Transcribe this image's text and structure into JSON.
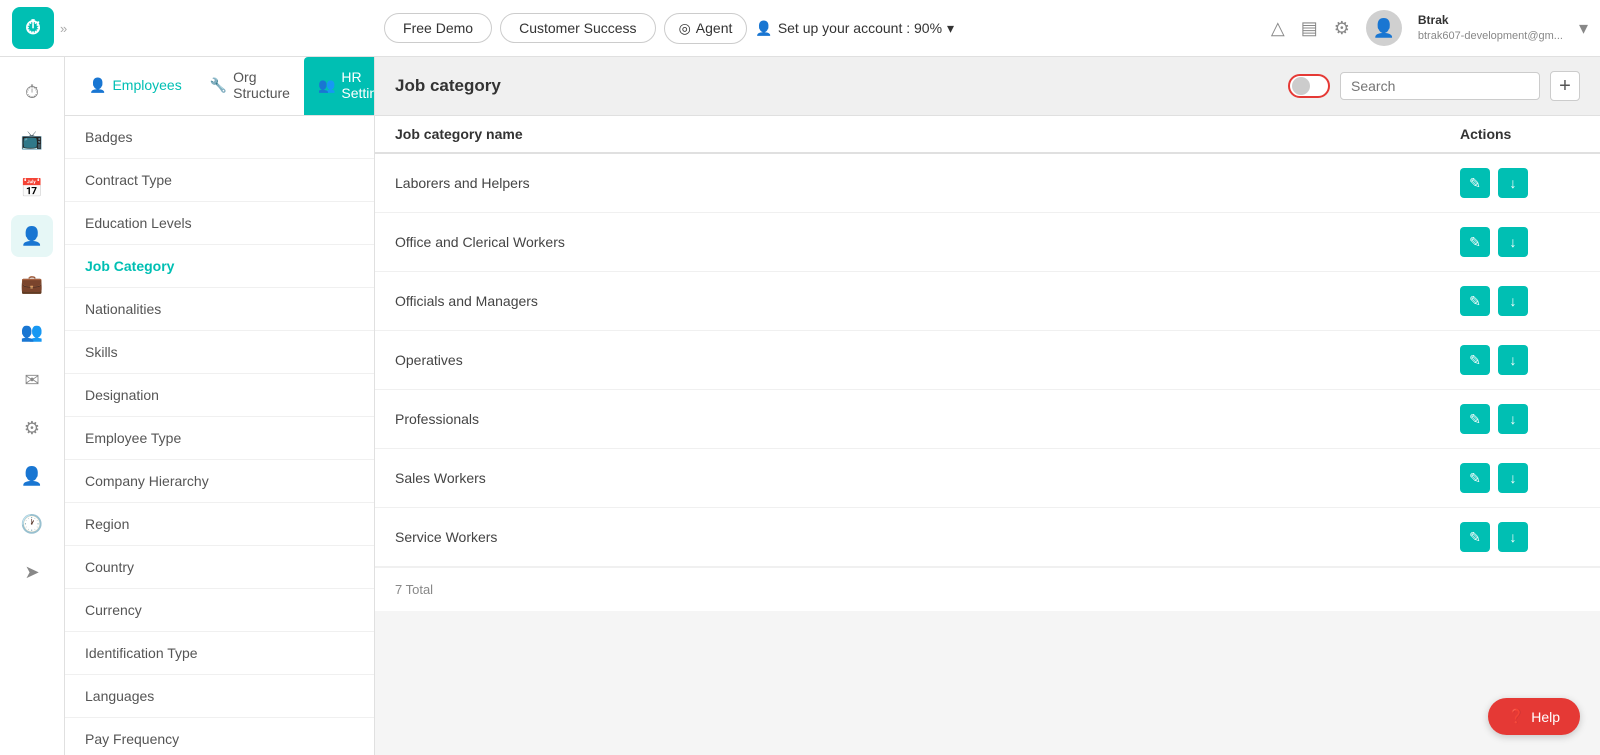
{
  "navbar": {
    "logo_text": "⏱",
    "expand_icon": "»",
    "free_demo_label": "Free Demo",
    "customer_success_label": "Customer Success",
    "agent_label": "Agent",
    "agent_icon": "◎",
    "setup_label": "Set up your account : 90%",
    "setup_icon": "▾",
    "alert_icon": "△",
    "doc_icon": "▤",
    "settings_icon": "⚙",
    "user_name": "Btrak",
    "user_email": "btrak607-development@gm...",
    "user_icon": "▾"
  },
  "left_sidebar": {
    "icons": [
      {
        "name": "clock-icon",
        "glyph": "⏱",
        "active": false
      },
      {
        "name": "tv-icon",
        "glyph": "📺",
        "active": false
      },
      {
        "name": "calendar-icon",
        "glyph": "📅",
        "active": false
      },
      {
        "name": "person-icon",
        "glyph": "👤",
        "active": true
      },
      {
        "name": "briefcase-icon",
        "glyph": "💼",
        "active": false
      },
      {
        "name": "group-icon",
        "glyph": "👥",
        "active": false
      },
      {
        "name": "mail-icon",
        "glyph": "✉",
        "active": false
      },
      {
        "name": "gear-icon",
        "glyph": "⚙",
        "active": false
      },
      {
        "name": "user2-icon",
        "glyph": "👤",
        "active": false
      },
      {
        "name": "time-icon",
        "glyph": "🕐",
        "active": false
      },
      {
        "name": "send-icon",
        "glyph": "➤",
        "active": false
      }
    ]
  },
  "sub_sidebar": {
    "tabs": [
      {
        "label": "Employees",
        "icon": "👤",
        "active": false,
        "class": "tab-employees"
      },
      {
        "label": "Org Structure",
        "icon": "🔧",
        "active": false,
        "class": "tab-org"
      },
      {
        "label": "HR Settings",
        "icon": "👥",
        "active": true,
        "class": "tab-hr"
      }
    ],
    "menu_items": [
      {
        "label": "Badges",
        "active": false
      },
      {
        "label": "Contract Type",
        "active": false
      },
      {
        "label": "Education Levels",
        "active": false
      },
      {
        "label": "Job Category",
        "active": true
      },
      {
        "label": "Nationalities",
        "active": false
      },
      {
        "label": "Skills",
        "active": false
      },
      {
        "label": "Designation",
        "active": false
      },
      {
        "label": "Employee Type",
        "active": false
      },
      {
        "label": "Company Hierarchy",
        "active": false
      },
      {
        "label": "Region",
        "active": false
      },
      {
        "label": "Country",
        "active": false
      },
      {
        "label": "Currency",
        "active": false
      },
      {
        "label": "Identification Type",
        "active": false
      },
      {
        "label": "Languages",
        "active": false
      },
      {
        "label": "Pay Frequency",
        "active": false
      }
    ]
  },
  "main": {
    "title": "Job category",
    "search_placeholder": "Search",
    "add_icon": "+",
    "table": {
      "col_name": "Job category name",
      "col_actions": "Actions",
      "rows": [
        {
          "name": "Laborers and Helpers"
        },
        {
          "name": "Office and Clerical Workers"
        },
        {
          "name": "Officials and Managers"
        },
        {
          "name": "Operatives"
        },
        {
          "name": "Professionals"
        },
        {
          "name": "Sales Workers"
        },
        {
          "name": "Service Workers"
        }
      ],
      "total_label": "7 Total"
    },
    "edit_icon": "✎",
    "download_icon": "↓",
    "help_label": "Help"
  }
}
